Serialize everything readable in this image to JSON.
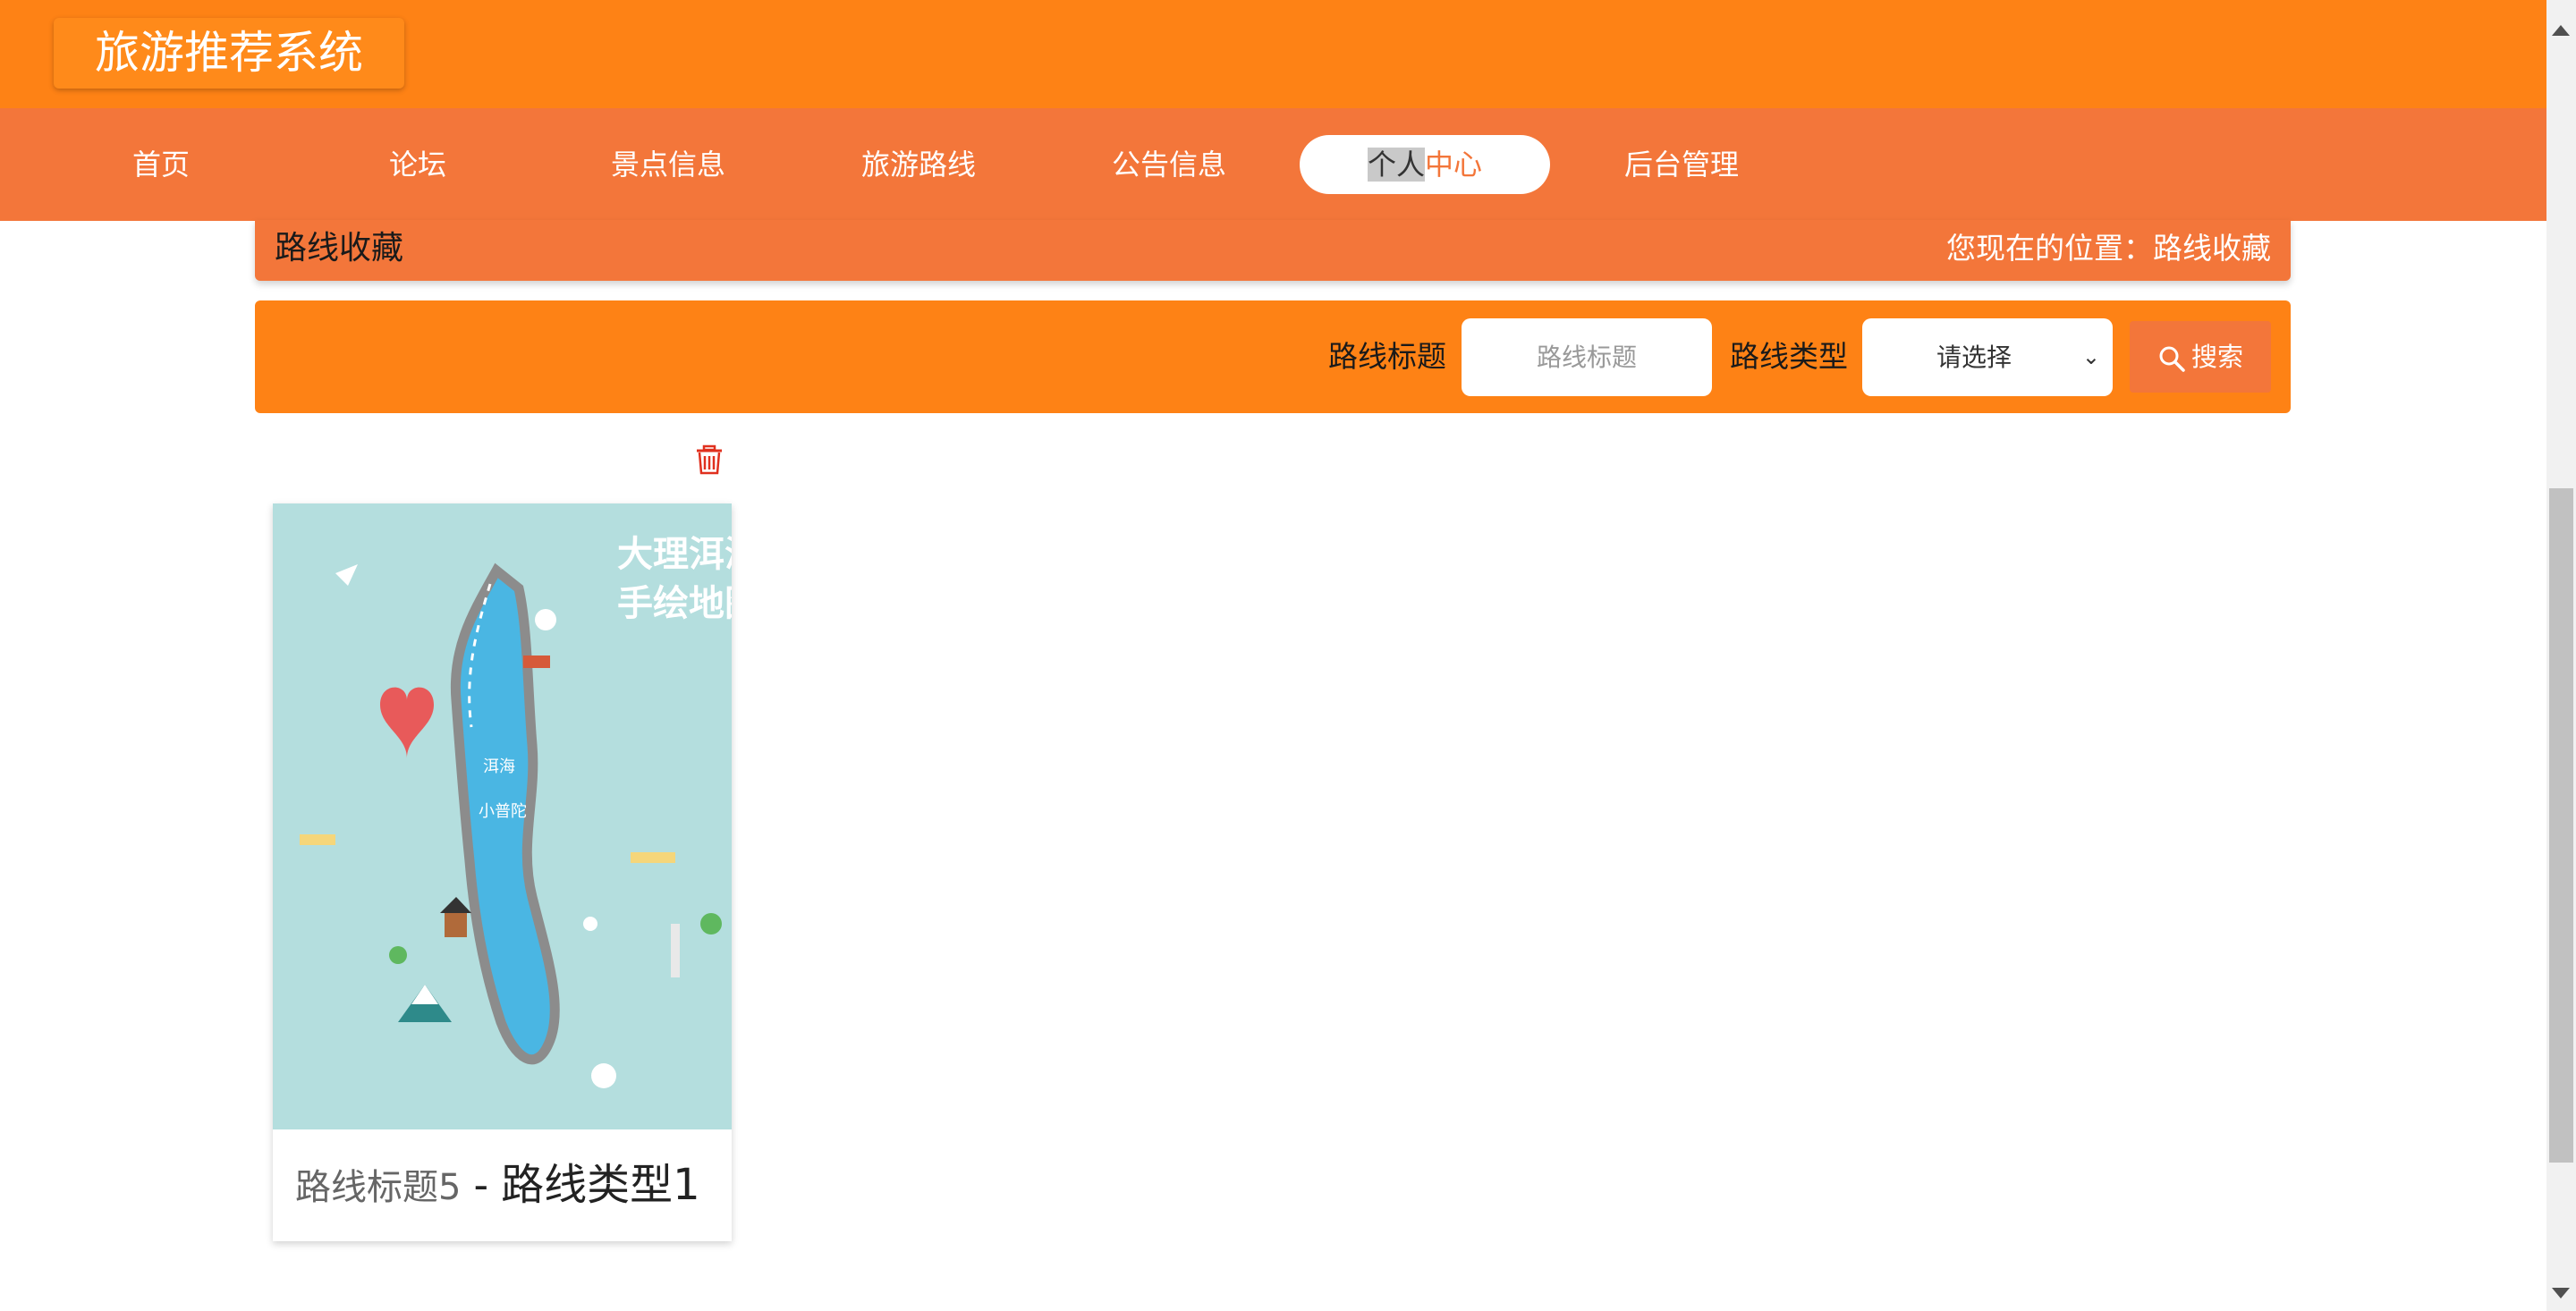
{
  "app": {
    "title": "旅游推荐系统"
  },
  "nav": {
    "items": [
      "首页",
      "论坛",
      "景点信息",
      "旅游路线",
      "公告信息"
    ],
    "active_part1": "个人",
    "active_part2": "中心",
    "last": "后台管理"
  },
  "crumb": {
    "title": "路线收藏",
    "location": "您现在的位置：路线收藏"
  },
  "search": {
    "label_title": "路线标题",
    "placeholder_title": "路线标题",
    "label_type": "路线类型",
    "select_value": "请选择",
    "button": "搜索"
  },
  "card": {
    "map_title_line1": "大理洱海",
    "map_title_line2": "手绘地图",
    "lake_label": "洱海",
    "island_label": "小普陀",
    "route_title": "路线标题5",
    "separator": "-",
    "route_type": "路线类型1"
  },
  "colors": {
    "primary": "#fe8215",
    "secondary": "#f3763a",
    "map_bg": "#b4dede",
    "lake": "#4ab6e3"
  },
  "icons": [
    "trash-icon",
    "search-icon",
    "chevron-down-icon"
  ]
}
